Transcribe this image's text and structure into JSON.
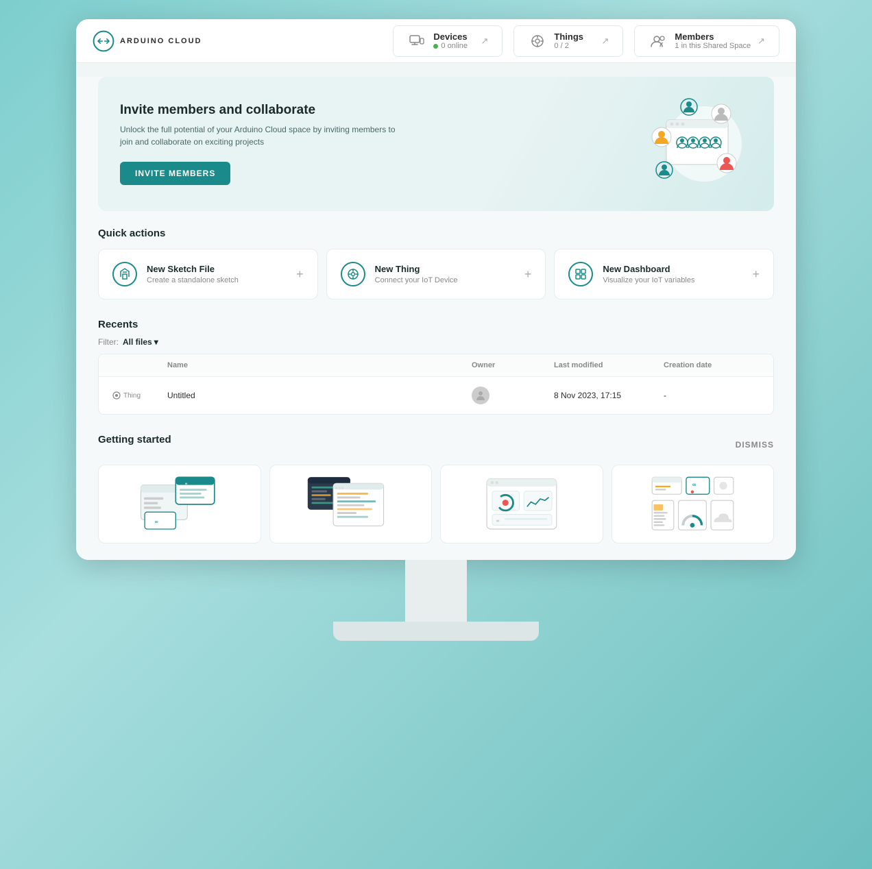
{
  "header": {
    "logo_text": "ARDUINO CLOUD",
    "devices": {
      "label": "Devices",
      "sub": "0 online"
    },
    "things": {
      "label": "Things",
      "sub": "0 / 2"
    },
    "members": {
      "label": "Members",
      "sub": "1 in this Shared Space"
    }
  },
  "banner": {
    "title": "Invite members and collaborate",
    "sub": "Unlock the full potential of your Arduino Cloud space by inviting members to join and collaborate on exciting projects",
    "invite_button": "INVITE MEMBERS"
  },
  "quick_actions": {
    "section_title": "Quick actions",
    "items": [
      {
        "name": "New Sketch File",
        "desc": "Create a standalone sketch"
      },
      {
        "name": "New Thing",
        "desc": "Connect your IoT Device"
      },
      {
        "name": "New Dashboard",
        "desc": "Visualize your IoT variables"
      }
    ]
  },
  "recents": {
    "section_title": "Recents",
    "filter_label": "Filter:",
    "filter_value": "All files",
    "table": {
      "headers": [
        "",
        "Name",
        "Owner",
        "Last modified",
        "Creation date"
      ],
      "rows": [
        {
          "type": "Thing",
          "name": "Untitled",
          "owner_avatar": true,
          "last_modified": "8 Nov 2023, 17:15",
          "creation_date": "-"
        }
      ]
    }
  },
  "getting_started": {
    "section_title": "Getting started",
    "dismiss_label": "DISMISS"
  },
  "colors": {
    "teal": "#1a8a8a",
    "light_teal": "#7ecece",
    "bg": "#f5f9f9"
  }
}
